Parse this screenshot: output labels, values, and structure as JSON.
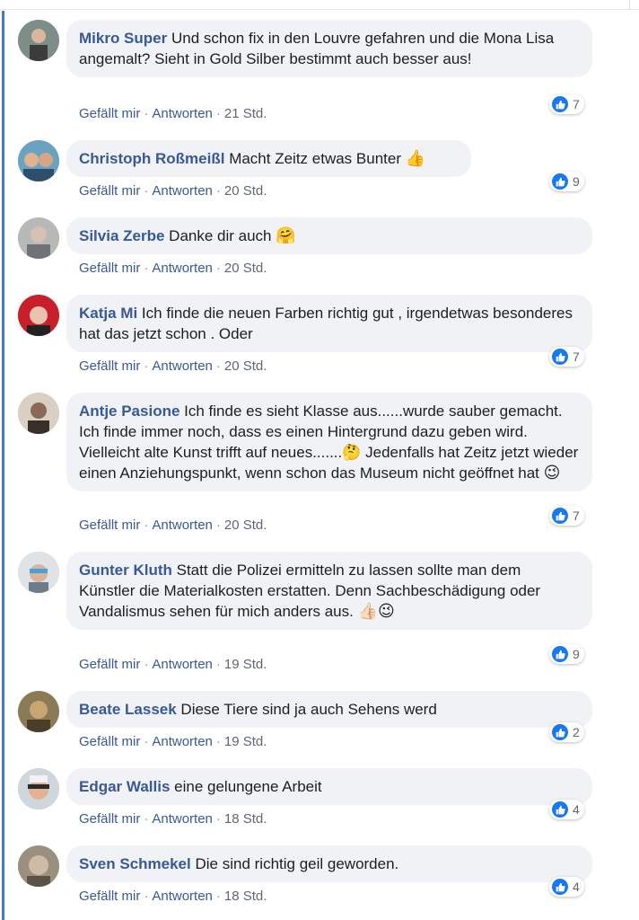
{
  "actions": {
    "like": "Gefällt mir",
    "reply": "Antworten",
    "sep": "·"
  },
  "colors": {
    "accent": "#385898",
    "thread": "#4a78c9",
    "like": "#1877f2",
    "bubble": "#f0f2f5"
  },
  "comments": [
    {
      "author": "Mikro Super",
      "text": "Und schon fix in den Louvre gefahren und die Mona Lisa angemalt? Sieht in Gold Silber bestimmt auch besser aus!",
      "emoji": "",
      "time": "21 Std.",
      "likes": "7",
      "avatar_icon": "profile-photo"
    },
    {
      "author": "Christoph Roßmeißl",
      "text": "Macht Zeitz etwas Bunter",
      "emoji": "👍",
      "time": "20 Std.",
      "likes": "9",
      "avatar_icon": "profile-photo"
    },
    {
      "author": "Silvia Zerbe",
      "text": "Danke dir auch",
      "emoji": "🤗",
      "time": "20 Std.",
      "likes": "",
      "avatar_icon": "profile-photo"
    },
    {
      "author": "Katja Mi",
      "text": "Ich finde die neuen Farben richtig gut , irgendetwas besonderes hat das jetzt schon . Oder",
      "emoji": "",
      "time": "20 Std.",
      "likes": "7",
      "avatar_icon": "profile-photo"
    },
    {
      "author": "Antje Pasione",
      "text": "Ich finde es sieht Klasse aus......wurde sauber gemacht. Ich finde immer noch, dass es einen Hintergrund dazu geben wird. Vielleicht alte Kunst trifft auf neues.......🤔 Jedenfalls hat Zeitz jetzt wieder einen Anziehungspunkt, wenn schon das Museum nicht geöffnet hat",
      "emoji": "😉",
      "time": "20 Std.",
      "likes": "7",
      "avatar_icon": "profile-photo"
    },
    {
      "author": "Gunter Kluth",
      "text": "Statt die Polizei ermitteln zu lassen sollte man dem Künstler die Materialkosten erstatten. Denn Sachbeschädigung oder Vandalismus sehen für mich anders aus.",
      "emoji": "👍🏻😉",
      "time": "19 Std.",
      "likes": "9",
      "avatar_icon": "profile-photo"
    },
    {
      "author": "Beate Lassek",
      "text": "Diese Tiere sind ja auch Sehens werd",
      "emoji": "",
      "time": "19 Std.",
      "likes": "2",
      "avatar_icon": "profile-photo"
    },
    {
      "author": "Edgar Wallis",
      "text": "eine gelungene Arbeit",
      "emoji": "",
      "time": "18 Std.",
      "likes": "4",
      "avatar_icon": "profile-photo"
    },
    {
      "author": "Sven Schmekel",
      "text": "Die sind richtig geil geworden.",
      "emoji": "",
      "time": "18 Std.",
      "likes": "4",
      "avatar_icon": "profile-photo"
    }
  ]
}
